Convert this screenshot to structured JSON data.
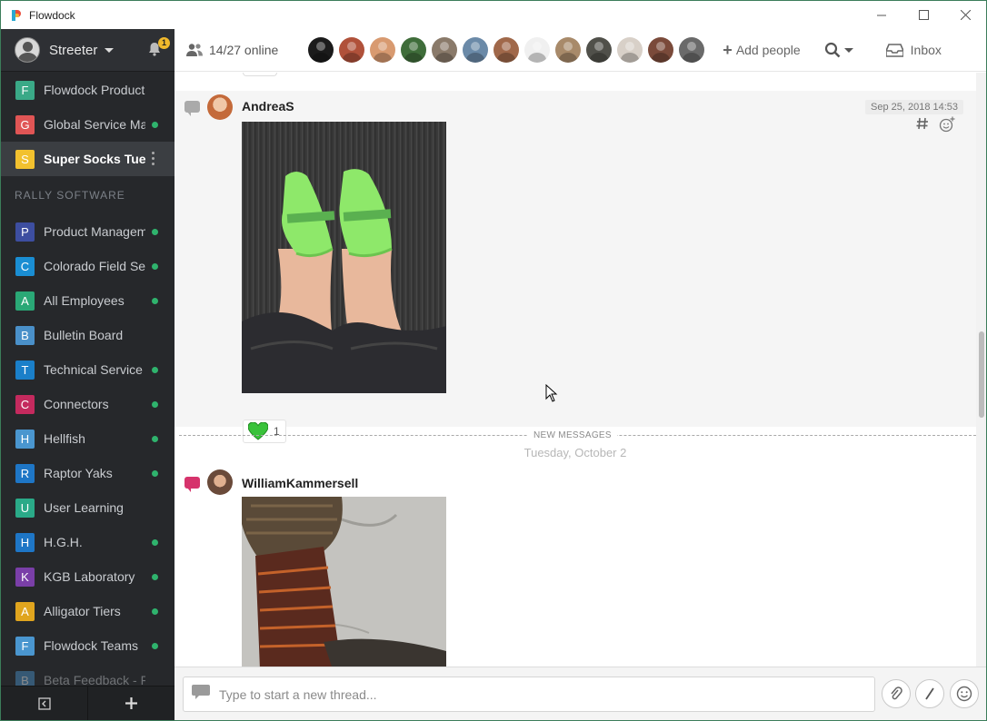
{
  "window": {
    "title": "Flowdock",
    "controls": {
      "minimize": "—",
      "maximize": "☐",
      "close": "✕"
    }
  },
  "sidebar": {
    "user_name": "Streeter",
    "notification_count": "1",
    "flows_top": [
      {
        "letter": "F",
        "name": "Flowdock Product ...",
        "color": "#3aa987",
        "status": "",
        "faded": false
      },
      {
        "letter": "G",
        "name": "Global Service Ma",
        "color": "#e05555",
        "status": "online",
        "faded": false
      },
      {
        "letter": "S",
        "name": "Super Socks Tues",
        "color": "#f2c12e",
        "status": "menu",
        "active": true,
        "faded": false
      }
    ],
    "org_name": "RALLY SOFTWARE",
    "flows_org": [
      {
        "letter": "P",
        "name": "Product Managem",
        "color": "#3d4ea0",
        "status": "online"
      },
      {
        "letter": "C",
        "name": "Colorado Field Se",
        "color": "#1a8ed3",
        "status": "online"
      },
      {
        "letter": "A",
        "name": "All Employees",
        "color": "#2aa876",
        "status": "online"
      },
      {
        "letter": "B",
        "name": "Bulletin Board",
        "color": "#4a90c9",
        "status": ""
      },
      {
        "letter": "T",
        "name": "Technical Service",
        "color": "#1a7fc9",
        "status": "online"
      },
      {
        "letter": "C",
        "name": "Connectors",
        "color": "#c42a5e",
        "status": "online"
      },
      {
        "letter": "H",
        "name": "Hellfish",
        "color": "#4a96cf",
        "status": "online"
      },
      {
        "letter": "R",
        "name": "Raptor Yaks",
        "color": "#1e76c6",
        "status": "online"
      },
      {
        "letter": "U",
        "name": "User Learning",
        "color": "#2aaa88",
        "status": ""
      },
      {
        "letter": "H",
        "name": "H.G.H.",
        "color": "#1e76c6",
        "status": "online"
      },
      {
        "letter": "K",
        "name": "KGB Laboratory",
        "color": "#7a3fa8",
        "status": "online"
      },
      {
        "letter": "A",
        "name": "Alligator Tiers",
        "color": "#e0a51e",
        "status": "online"
      },
      {
        "letter": "F",
        "name": "Flowdock Teams",
        "color": "#4a96cf",
        "status": "online"
      },
      {
        "letter": "B",
        "name": "Beta Feedback - F",
        "color": "#4a96cf",
        "status": "",
        "faded": true
      }
    ]
  },
  "topbar": {
    "online_text": "14/27 online",
    "people_colors": [
      "#1b1b1b",
      "#b0513a",
      "#d89a70",
      "#3f6d3a",
      "#8a7a6a",
      "#6b8aa8",
      "#a0684a",
      "#f0f0f0",
      "#a88a6a",
      "#50504a",
      "#d8d0c8",
      "#7a4a3a",
      "#6a6a6a"
    ],
    "add_people_label": "Add people",
    "inbox_label": "Inbox"
  },
  "messages": [
    {
      "author": "AndreaS",
      "timestamp": "Sep 25, 2018 14:53",
      "thread_color": "#aaaaaa",
      "reaction_count": "1"
    },
    {
      "author": "WilliamKammersell",
      "thread_color": "#d6336c"
    }
  ],
  "divider": {
    "new_messages_label": "NEW MESSAGES",
    "day_label": "Tuesday, October 2"
  },
  "composer": {
    "placeholder": "Type to start a new thread..."
  }
}
